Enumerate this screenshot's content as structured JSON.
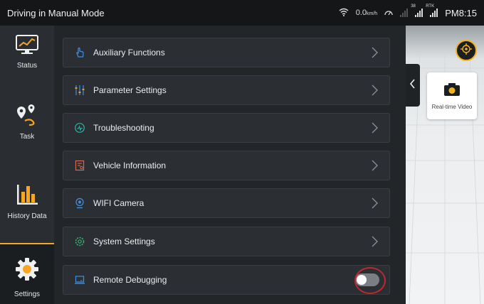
{
  "statusbar": {
    "title": "Driving in Manual Mode",
    "speed": "0.0",
    "speed_unit": "km/h",
    "sig1_tag": "38",
    "rtk_tag": "RTK",
    "clock": "PM8:15"
  },
  "sidebar": {
    "items": [
      {
        "label": "Status",
        "icon": "monitor-chart-icon"
      },
      {
        "label": "Task",
        "icon": "route-pin-icon"
      },
      {
        "label": "History Data",
        "icon": "bar-chart-icon"
      },
      {
        "label": "Settings",
        "icon": "gear-icon",
        "active": true
      }
    ]
  },
  "menu": {
    "items": [
      {
        "label": "Auxiliary Functions",
        "icon": "hand-pointer-icon"
      },
      {
        "label": "Parameter Settings",
        "icon": "sliders-icon"
      },
      {
        "label": "Troubleshooting",
        "icon": "wrench-circle-icon"
      },
      {
        "label": "Vehicle Information",
        "icon": "document-icon"
      },
      {
        "label": "WIFI Camera",
        "icon": "webcam-icon"
      },
      {
        "label": "System Settings",
        "icon": "cog-icon"
      },
      {
        "label": "Remote Debugging",
        "icon": "laptop-icon",
        "toggle": "off"
      }
    ]
  },
  "scene": {
    "video_label": "Real-time Video"
  },
  "colors": {
    "accent": "#f5a623",
    "highlight": "#c0282d",
    "sidebar_bg": "#2a2e33",
    "row_bg": "#2b2f34"
  }
}
